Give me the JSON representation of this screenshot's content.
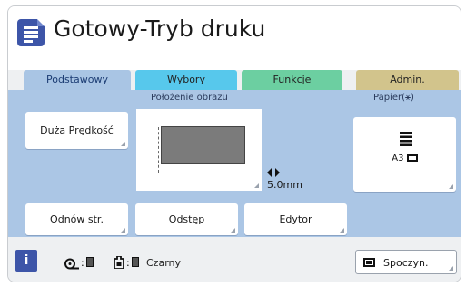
{
  "window": {
    "title": "Gotowy-Tryb druku"
  },
  "tabs": [
    {
      "label": "Podstawowy",
      "selected": true
    },
    {
      "label": "Wybory",
      "selected": false
    },
    {
      "label": "Funkcje",
      "selected": false
    },
    {
      "label": "Admin.",
      "selected": false
    }
  ],
  "section_labels": {
    "image_position": "Położenie obrazu",
    "paper": "Papier(⚹)"
  },
  "buttons": {
    "high_speed": "Duża Prędkość",
    "refresh": "Odnów str.",
    "spacing": "Odstęp",
    "editor": "Edytor",
    "standby": "Spoczyn."
  },
  "paper": {
    "size": "A3"
  },
  "offset": {
    "value": "5.0mm"
  },
  "status": {
    "ink_label": "Czarny"
  },
  "icons": {
    "app": "document-list-icon",
    "move": "left-right-arrows-icon",
    "info": "info-icon",
    "drum": "drum-icon",
    "ink": "ink-cartridge-icon",
    "paper_feed": "paper-stack-icon",
    "standby": "screen-icon"
  },
  "colors": {
    "accent": "#3d55a8",
    "tab_basic": "#a9c5e4",
    "tab_options": "#57c8ec",
    "tab_functions": "#6ccfa1",
    "tab_admin": "#d2c48c"
  }
}
